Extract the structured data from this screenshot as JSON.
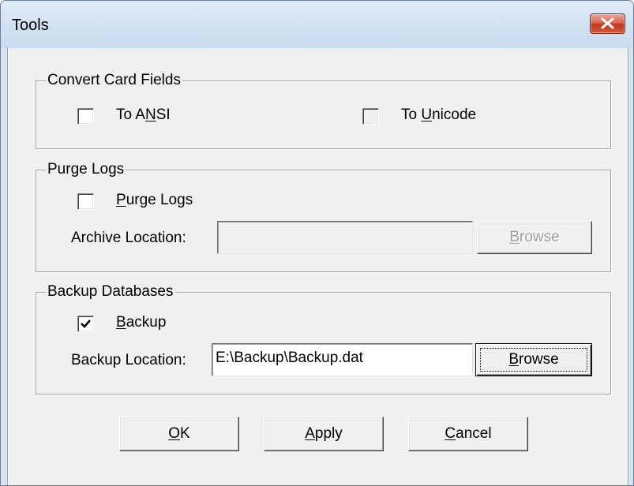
{
  "window": {
    "title": "Tools",
    "close_icon": "close-icon"
  },
  "convert": {
    "group_label": "Convert Card Fields",
    "to_ansi": {
      "pre": "To A",
      "mnemonic": "N",
      "post": "SI",
      "checked": false
    },
    "to_unicode": {
      "pre": "To ",
      "mnemonic": "U",
      "post": "nicode",
      "checked": false
    }
  },
  "purge": {
    "group_label": "Purge Logs",
    "checkbox": {
      "mnemonic": "P",
      "post": "urge Logs",
      "checked": false
    },
    "archive_label": "Archive Location:",
    "archive_value": "",
    "browse": {
      "mnemonic": "B",
      "post": "rowse",
      "enabled": false
    }
  },
  "backup": {
    "group_label": "Backup Databases",
    "checkbox": {
      "mnemonic": "B",
      "post": "ackup",
      "checked": true
    },
    "location_label": "Backup Location:",
    "location_value": "E:\\Backup\\Backup.dat",
    "browse": {
      "mnemonic": "B",
      "post": "rowse",
      "enabled": true
    }
  },
  "buttons": {
    "ok": {
      "mnemonic": "O",
      "post": "K"
    },
    "apply": {
      "mnemonic": "A",
      "post": "pply"
    },
    "cancel": {
      "mnemonic": "C",
      "post": "ancel"
    }
  },
  "colors": {
    "titlebar": "#d1e0f0",
    "client": "#f0f0f0",
    "close": "#c7452a"
  }
}
